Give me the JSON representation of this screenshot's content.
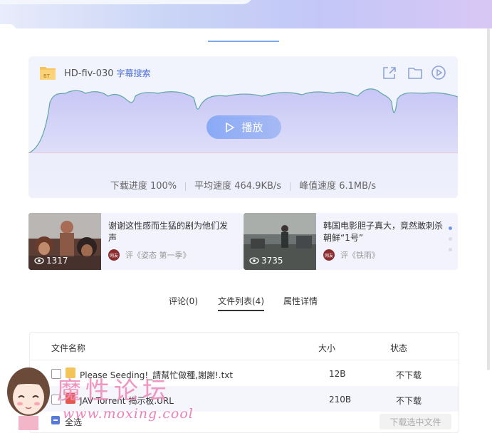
{
  "player": {
    "file_badge": "BT",
    "file_name": "HD-fiv-030",
    "subtitle_search": "字幕搜索",
    "play_label": "播放",
    "progress_label": "下载进度 100%",
    "avg_speed": "平均速度 464.9KB/s",
    "peak_speed": "峰值速度 6.1MB/s",
    "progress_value": 1.0
  },
  "recommend": [
    {
      "title": "谢谢这性感而生猛的剧为他们发声",
      "views": "1317",
      "source": "评《姿态 第一季》",
      "badge": "网友"
    },
    {
      "title": "韩国电影胆子真大，竟然敢刺杀朝鲜“1号”",
      "views": "3735",
      "source": "评《铁雨》",
      "badge": "网友"
    }
  ],
  "tabs": [
    "评论(0)",
    "文件列表(4)",
    "属性详情"
  ],
  "active_tab": "文件列表(4)",
  "files": {
    "headers": {
      "name": "文件名称",
      "size": "大小",
      "status": "状态"
    },
    "rows": [
      {
        "name": "Please Seeding!_請幫忙做種,謝謝!.txt",
        "size": "12B",
        "status": "不下载"
      },
      {
        "name": "JAV Torrent 揭示板.URL",
        "size": "210B",
        "status": "不下载"
      }
    ],
    "select_all": "全选",
    "download_selected": "下载选中文件"
  },
  "watermark": {
    "text": "魔性论坛",
    "url": "www.moxing.cool"
  },
  "colors": {
    "accent": "#7aa7ee",
    "play_button": "#92aef6",
    "wave_fill": "#cfd0f7",
    "checkbox_active": "#5779d8",
    "watermark": "#ef8fbc"
  }
}
